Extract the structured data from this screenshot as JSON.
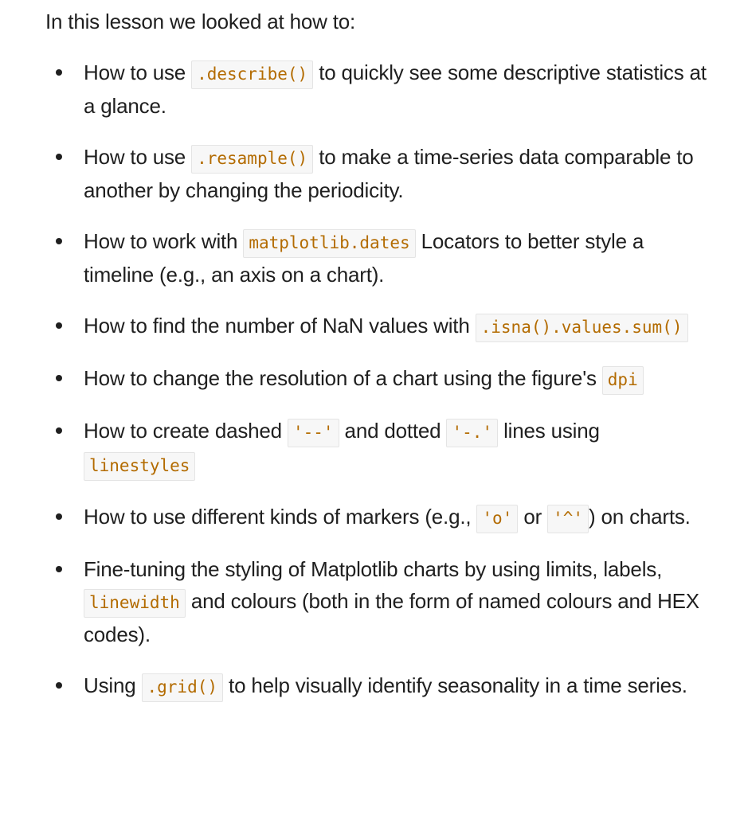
{
  "intro": "In this lesson we looked at how to:",
  "items": [
    {
      "t1": "How to use ",
      "c1": ".describe()",
      "t2": " to quickly see some descriptive statistics at a glance."
    },
    {
      "t1": "How to use ",
      "c1": ".resample()",
      "t2": " to make a time-series data comparable to another by changing the periodicity."
    },
    {
      "t1": "How to work with ",
      "c1": "matplotlib.dates",
      "t2": " Locators to better style a timeline (e.g., an axis on a chart)."
    },
    {
      "t1": "How to find the number of NaN values with ",
      "c1": ".isna().values.sum()"
    },
    {
      "t1": "How to change the resolution of a chart using the figure's ",
      "c1": "dpi"
    },
    {
      "t1": "How to create dashed ",
      "c1": "'--'",
      "t2": " and dotted ",
      "c2": "'-.'",
      "t3": " lines using ",
      "c3": "linestyles"
    },
    {
      "t1": "How to use different kinds of markers (e.g., ",
      "c1": "'o'",
      "t2": " or ",
      "c2": "'^'",
      "t3": ") on charts."
    },
    {
      "t1": "Fine-tuning the styling of Matplotlib charts by using limits, labels, ",
      "c1": "linewidth",
      "t2": " and colours (both in the form of named colours and HEX codes)."
    },
    {
      "t1": "Using ",
      "c1": ".grid()",
      "t2": " to help visually identify seasonality in a time series."
    }
  ],
  "colors": {
    "text": "#1f1f1f",
    "code_text": "#b36b00",
    "code_bg": "#f7f7f7"
  }
}
